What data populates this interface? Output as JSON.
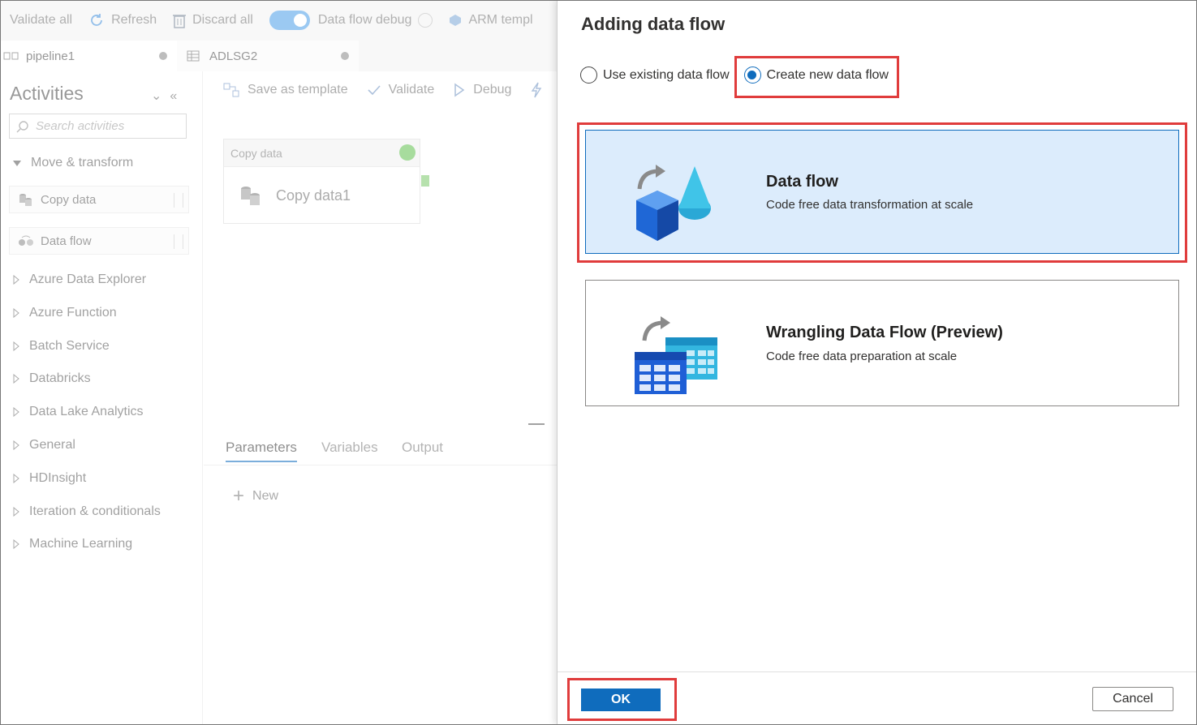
{
  "topbar": {
    "validate_all": "Validate all",
    "refresh": "Refresh",
    "discard_all": "Discard all",
    "data_flow_debug": "Data flow debug",
    "arm_template": "ARM templ"
  },
  "tabs": [
    {
      "label": "pipeline1"
    },
    {
      "label": "ADLSG2"
    }
  ],
  "sidebar": {
    "title": "Activities",
    "search_placeholder": "Search activities",
    "open_group": "Move & transform",
    "items": [
      {
        "label": "Copy data"
      },
      {
        "label": "Data flow"
      }
    ],
    "groups": [
      "Azure Data Explorer",
      "Azure Function",
      "Batch Service",
      "Databricks",
      "Data Lake Analytics",
      "General",
      "HDInsight",
      "Iteration & conditionals",
      "Machine Learning"
    ]
  },
  "canvas": {
    "toolbar": {
      "save_as_template": "Save as template",
      "validate": "Validate",
      "debug": "Debug"
    },
    "node": {
      "type": "Copy data",
      "name": "Copy data1"
    },
    "bottom_tabs": [
      "Parameters",
      "Variables",
      "Output"
    ],
    "new_label": "New"
  },
  "dialog": {
    "title": "Adding data flow",
    "radio_existing": "Use existing data flow",
    "radio_new": "Create new data flow",
    "selected_option": "Create new data flow",
    "cards": [
      {
        "title": "Data flow",
        "desc": "Code free data transformation at scale",
        "selected": true
      },
      {
        "title": "Wrangling Data Flow (Preview)",
        "desc": "Code free data preparation at scale",
        "selected": false
      }
    ],
    "ok": "OK",
    "cancel": "Cancel"
  },
  "colors": {
    "accent": "#0f6cbd",
    "highlight": "#e03c3c",
    "selected_card": "#dcecfc"
  }
}
